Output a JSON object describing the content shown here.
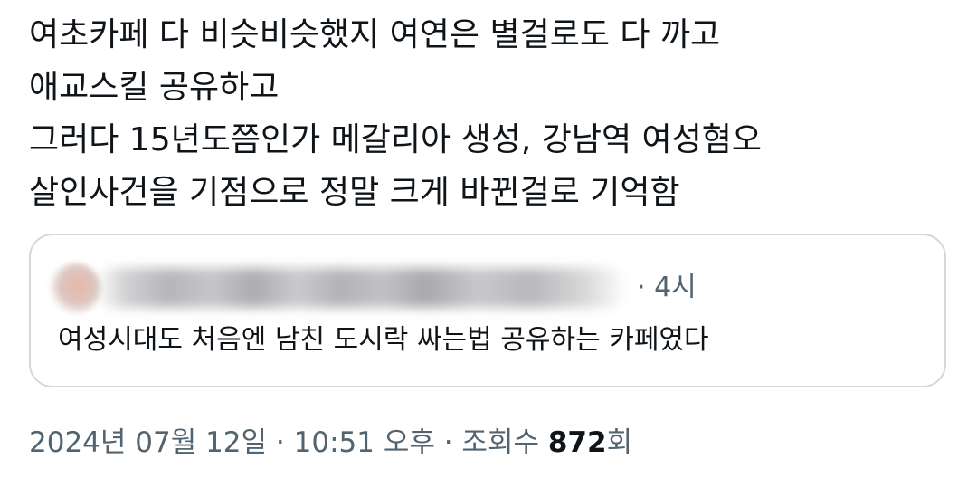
{
  "tweet": {
    "lines": [
      "여초카페 다 비슷비슷했지 여연은 별걸로도 다 까고",
      "애교스킬 공유하고",
      "그러다 15년도쯤인가 메갈리아 생성, 강남역 여성혐오",
      "살인사건을 기점으로 정말 크게 바뀐걸로 기억함"
    ]
  },
  "quote": {
    "time": "· 4시",
    "text": "여성시대도 처음엔 남친 도시락 싸는법 공유하는 카페였다"
  },
  "meta": {
    "date": "2024년 07월 12일",
    "sep1": " · ",
    "time": "10:51 오후",
    "sep2": " · ",
    "views_label": "조회수 ",
    "views_count": "872",
    "views_suffix": "회"
  }
}
